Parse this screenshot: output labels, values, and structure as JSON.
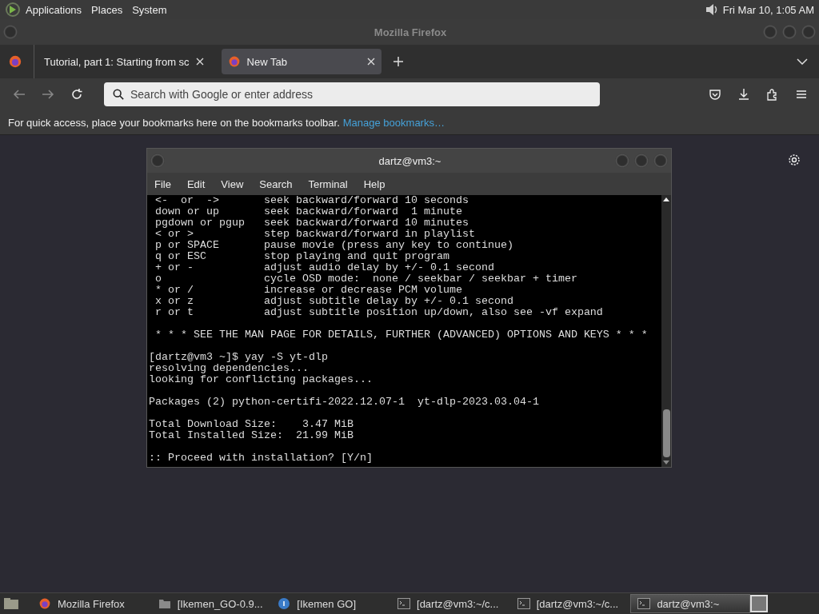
{
  "top_panel": {
    "menus": [
      "Applications",
      "Places",
      "System"
    ],
    "clock": "Fri Mar 10,  1:05 AM"
  },
  "window": {
    "title": "Mozilla Firefox"
  },
  "tabs": [
    {
      "label": "Tutorial, part 1: Starting from sc",
      "selected": false
    },
    {
      "label": "New Tab",
      "selected": true
    }
  ],
  "address_bar": {
    "placeholder": "Search with Google or enter address"
  },
  "bookmarks_bar": {
    "text": "For quick access, place your bookmarks here on the bookmarks toolbar.",
    "link": "Manage bookmarks…"
  },
  "terminal": {
    "title": "dartz@vm3:~",
    "menus": [
      "File",
      "Edit",
      "View",
      "Search",
      "Terminal",
      "Help"
    ],
    "blocks": [
      [
        " <-  or  ->       seek backward/forward 10 seconds",
        " down or up       seek backward/forward  1 minute",
        " pgdown or pgup   seek backward/forward 10 minutes",
        " < or >           step backward/forward in playlist",
        " p or SPACE       pause movie (press any key to continue)",
        " q or ESC         stop playing and quit program",
        " + or -           adjust audio delay by +/- 0.1 second",
        " o                cycle OSD mode:  none / seekbar / seekbar + timer",
        " * or /           increase or decrease PCM volume",
        " x or z           adjust subtitle delay by +/- 0.1 second",
        " r or t           adjust subtitle position up/down, also see -vf expand"
      ],
      [
        " * * * SEE THE MAN PAGE FOR DETAILS, FURTHER (ADVANCED) OPTIONS AND KEYS * * *"
      ],
      [
        "[dartz@vm3 ~]$ yay -S yt-dlp",
        "resolving dependencies...",
        "looking for conflicting packages..."
      ],
      [
        "Packages (2) python-certifi-2022.12.07-1  yt-dlp-2023.03.04-1"
      ],
      [
        "Total Download Size:    3.47 MiB",
        "Total Installed Size:  21.99 MiB"
      ],
      [
        ":: Proceed with installation? [Y/n]"
      ]
    ]
  },
  "taskbar": [
    {
      "kind": "firefox",
      "label": "Mozilla Firefox",
      "selected": false
    },
    {
      "kind": "folder",
      "label": "[Ikemen_GO-0.9...",
      "selected": false
    },
    {
      "kind": "app",
      "label": "[Ikemen GO]",
      "selected": false
    },
    {
      "kind": "terminal",
      "label": "[dartz@vm3:~/c...",
      "selected": false
    },
    {
      "kind": "terminal",
      "label": "[dartz@vm3:~/c...",
      "selected": false
    },
    {
      "kind": "terminal",
      "label": "dartz@vm3:~",
      "selected": true
    }
  ]
}
